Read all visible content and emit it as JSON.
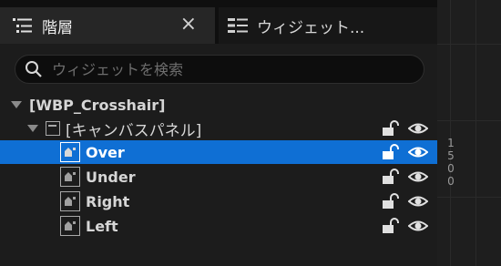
{
  "tabs": [
    {
      "label": "階層",
      "active": true,
      "close": "×"
    },
    {
      "label": "ウィジェット..."
    }
  ],
  "search": {
    "placeholder": "ウィジェットを検索",
    "value": ""
  },
  "tree": {
    "root": "[WBP_Crosshair]",
    "canvas": "[キャンバスパネル]",
    "items": [
      {
        "label": "Over",
        "selected": true
      },
      {
        "label": "Under"
      },
      {
        "label": "Right"
      },
      {
        "label": "Left"
      }
    ]
  },
  "ruler": {
    "digits": [
      "1",
      "5",
      "0",
      "0"
    ]
  },
  "colors": {
    "selection": "#0f6fd4",
    "background": "#1c1c1c"
  },
  "icons": [
    "hierarchy-icon",
    "widgets-icon",
    "search-icon",
    "lock-open-icon",
    "eye-icon",
    "canvas-panel-icon",
    "widget-image-icon"
  ]
}
